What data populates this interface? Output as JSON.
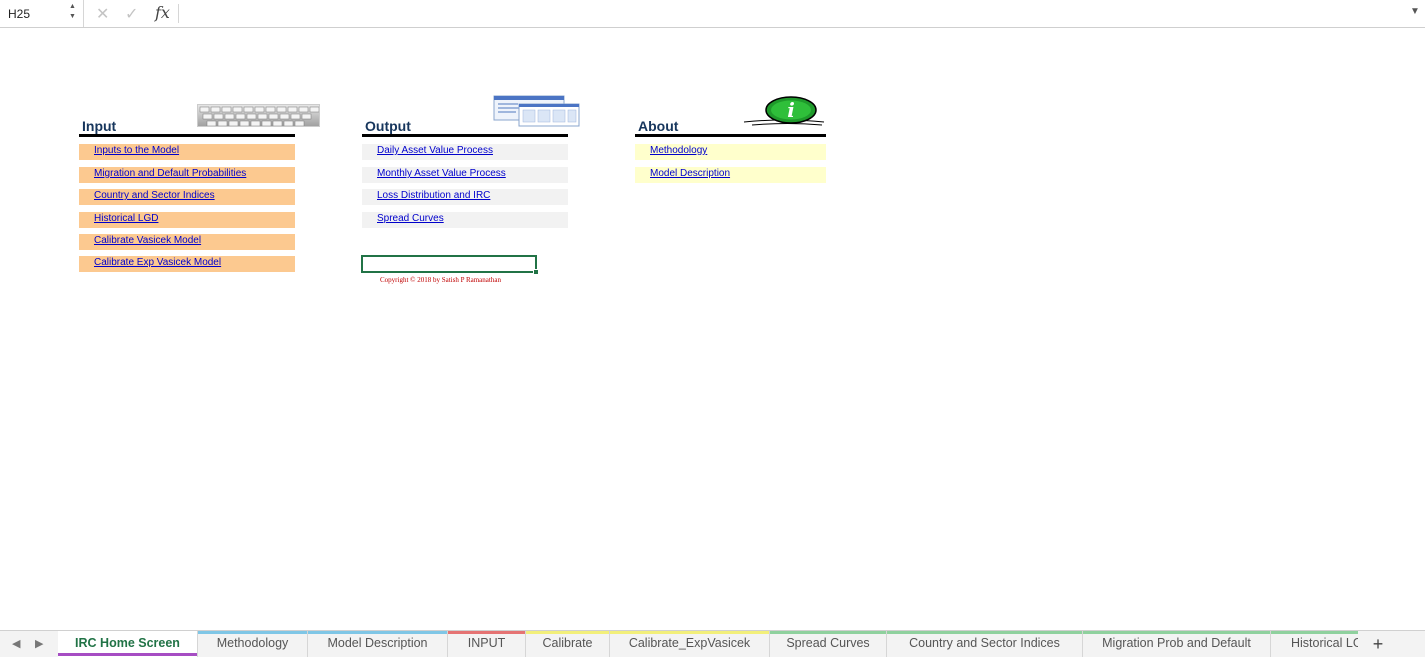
{
  "formula_bar": {
    "cell_ref": "H25",
    "cancel_icon": "x-icon",
    "confirm_icon": "check-icon",
    "function_icon": "fx-icon",
    "formula_value": ""
  },
  "sections": {
    "input": {
      "title": "Input",
      "links": [
        "Inputs to the Model",
        "Migration and Default Probabilities",
        "Country and Sector Indices",
        "Historical LGD",
        "Calibrate Vasicek Model",
        "Calibrate Exp Vasicek Model"
      ]
    },
    "output": {
      "title": "Output",
      "links": [
        "Daily Asset Value Process",
        "Monthly Asset Value Process",
        "Loss Distribution and IRC",
        "Spread Curves"
      ]
    },
    "about": {
      "title": "About",
      "links": [
        "Methodology",
        "Model Description"
      ]
    }
  },
  "copyright": "Copyright © 2018 by Satish P Ramanathan",
  "colors": {
    "input_bg": "#fcc990",
    "output_bg": "#f2f2f2",
    "about_bg": "#ffffcc",
    "link": "#0000cc",
    "title": "#17365d",
    "selection": "#217346"
  },
  "sheet_tabs": [
    {
      "label": "IRC Home Screen",
      "active": true,
      "color": "#a64dc3"
    },
    {
      "label": "Methodology",
      "color": "#7fc6e6"
    },
    {
      "label": "Model Description",
      "color": "#7fc6e6"
    },
    {
      "label": "INPUT",
      "color": "#e57373"
    },
    {
      "label": "Calibrate",
      "color": "#f2ef7a"
    },
    {
      "label": "Calibrate_ExpVasicek",
      "color": "#f2ef7a"
    },
    {
      "label": "Spread Curves",
      "color": "#8fd19e"
    },
    {
      "label": "Country and Sector Indices",
      "color": "#8fd19e"
    },
    {
      "label": "Migration Prob and Default",
      "color": "#8fd19e"
    },
    {
      "label": "Historical LGD",
      "color": "#8fd19e"
    }
  ],
  "add_sheet_label": "+"
}
